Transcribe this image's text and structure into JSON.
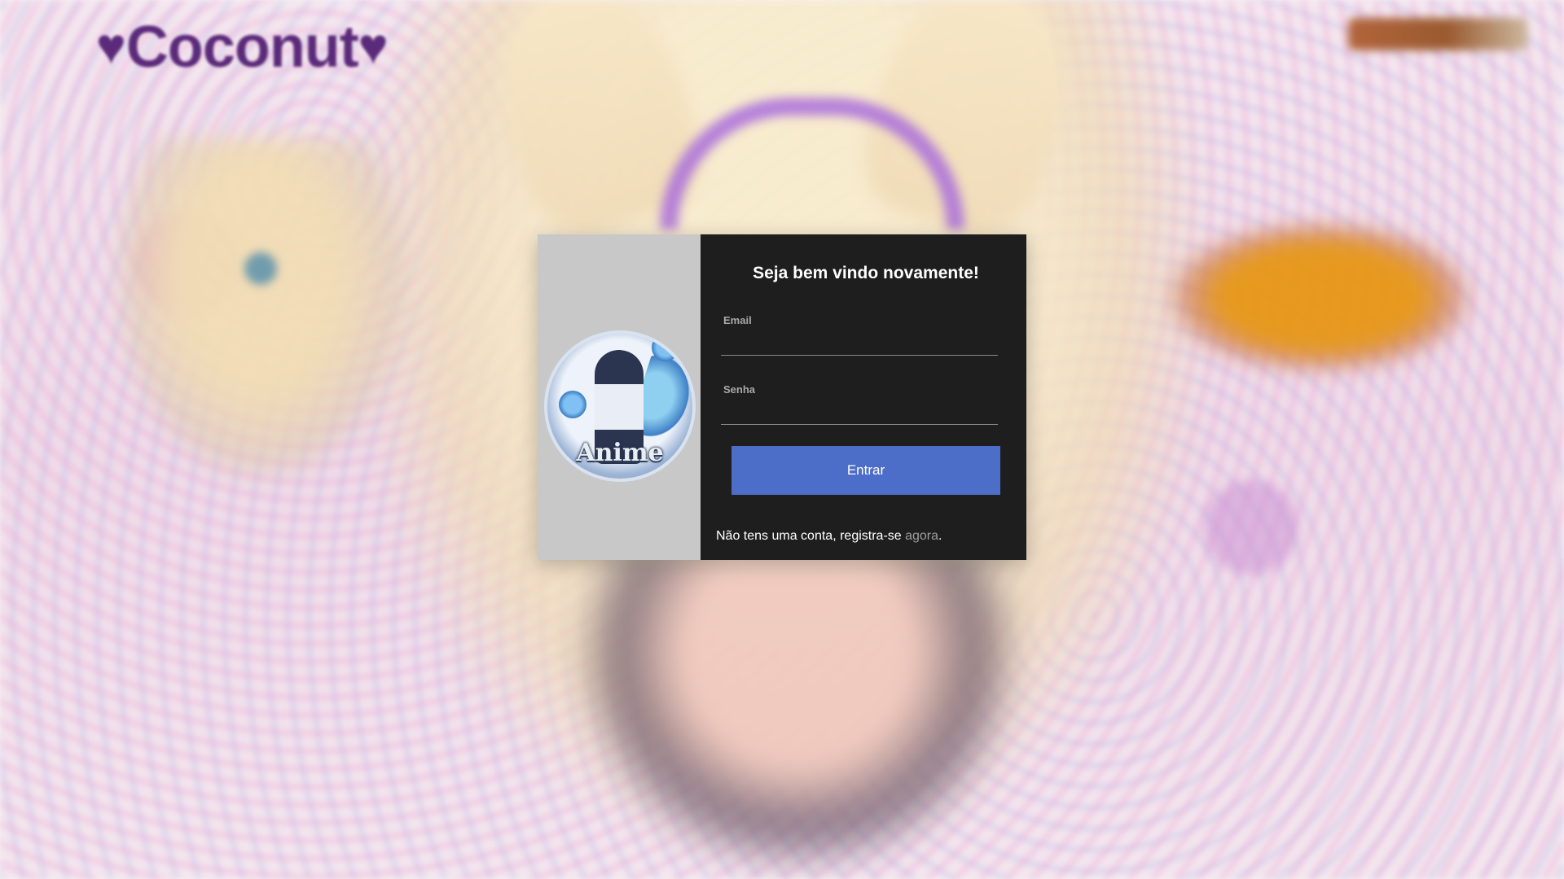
{
  "brand": {
    "name": "Coconut",
    "heart_left": "♥",
    "heart_right": "♥"
  },
  "top_right_badge": "",
  "avatar": {
    "label": "Anime"
  },
  "login": {
    "title": "Seja bem vindo novamente!",
    "email_label": "Email",
    "email_value": "",
    "password_label": "Senha",
    "password_value": "",
    "submit_label": "Entrar",
    "register_text": "Não tens uma conta, registra-se ",
    "register_link": "agora",
    "register_suffix": "."
  },
  "colors": {
    "card_dark": "#1f1e1f",
    "card_left": "#c8c8c8",
    "button": "#4d6ec8",
    "brand": "#5b2a7a",
    "link": "#9d9d9d"
  }
}
